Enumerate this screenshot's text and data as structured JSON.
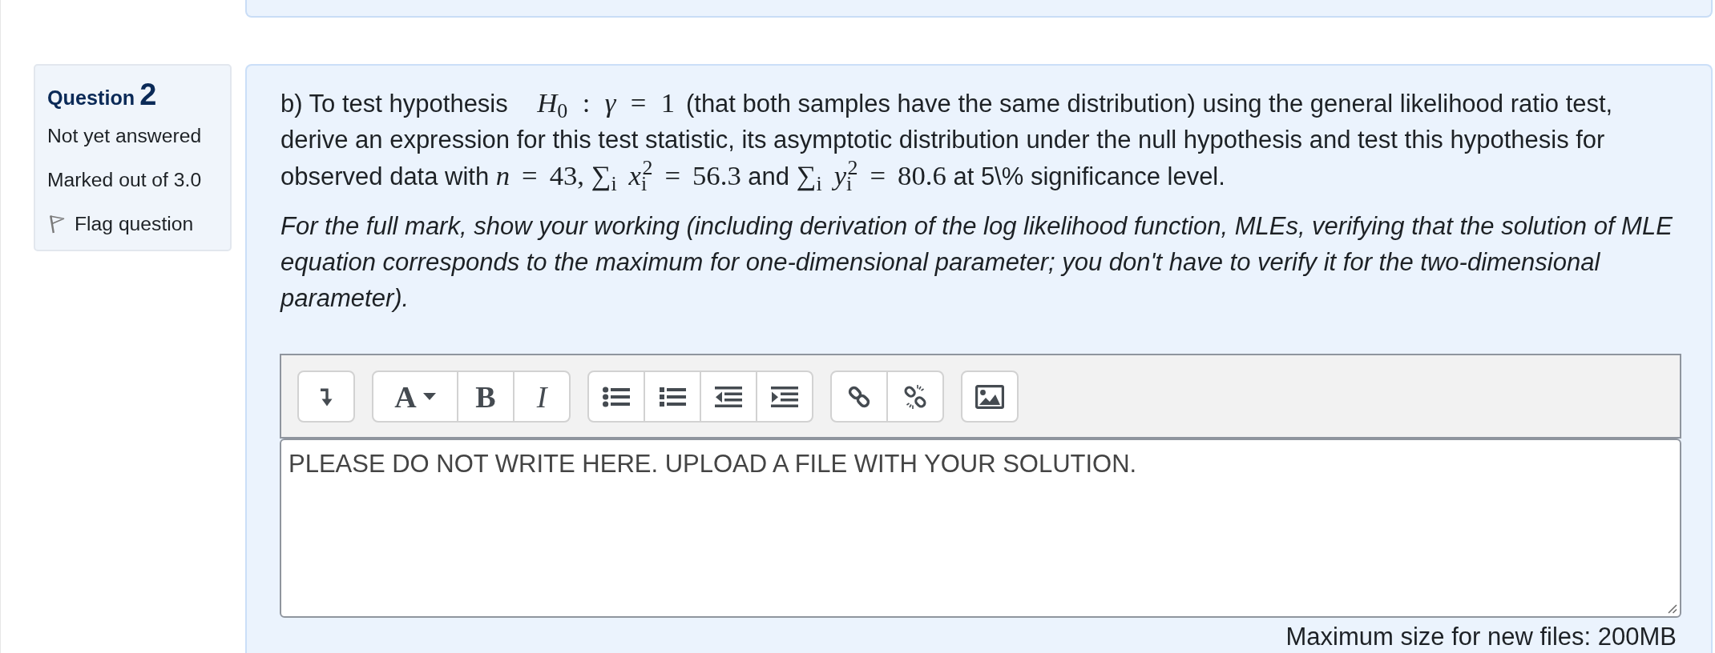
{
  "question_info": {
    "label": "Question",
    "number": "2",
    "state": "Not yet answered",
    "grade": "Marked out of 3.0",
    "flag": {
      "label": "Flag question",
      "flagged": false
    }
  },
  "question_text": {
    "paragraphs": [
      {
        "kind": "statement",
        "segments": [
          {
            "kind": "text",
            "text": "b) To test hypothesis"
          },
          {
            "kind": "math",
            "text": "*H*$_{0}$ : *γ* = 1"
          },
          {
            "kind": "text",
            "text": "(that both samples have the same distribution) using the general likelihood ratio test, derive an expression for this test statistic, its asymptotic distribution under the null hypothesis and test this hypothesis for observed data with"
          },
          {
            "kind": "math",
            "text": "*n* = 43,"
          },
          {
            "kind": "math",
            "text": "∑$_{i}$ *x*$_{i}$$^{2}$ = 56.3"
          },
          {
            "kind": "text",
            "text": "and"
          },
          {
            "kind": "math",
            "text": "∑$_{i}$ *y*$_{i}$$^{2}$ = 80.6"
          },
          {
            "kind": "text",
            "text": "at 5\\% significance level."
          }
        ]
      },
      {
        "kind": "instruction",
        "segments": [
          {
            "kind": "text",
            "text": "For the full mark, show your working (including derivation of the log likelihood function, MLEs, verifying that the solution of MLE equation corresponds to the maximum for one-dimensional parameter; you don't have to verify it for the two-dimensional parameter)."
          }
        ]
      }
    ]
  },
  "editor": {
    "toolbar_groups": [
      {
        "buttons": [
          {
            "kind": "toggle"
          }
        ]
      },
      {
        "buttons": [
          {
            "kind": "style",
            "label": "A"
          },
          {
            "kind": "bold",
            "label": "B"
          },
          {
            "kind": "italic",
            "label": "I"
          }
        ]
      },
      {
        "buttons": [
          {
            "kind": "bullets"
          },
          {
            "kind": "numbering"
          },
          {
            "kind": "outdent"
          },
          {
            "kind": "indent"
          }
        ]
      },
      {
        "buttons": [
          {
            "kind": "link"
          },
          {
            "kind": "unlink"
          }
        ]
      },
      {
        "buttons": [
          {
            "kind": "image"
          }
        ]
      }
    ],
    "content": "PLEASE DO NOT WRITE HERE. UPLOAD A FILE WITH YOUR SOLUTION."
  },
  "file_limit": "Maximum size for new files: 200MB"
}
